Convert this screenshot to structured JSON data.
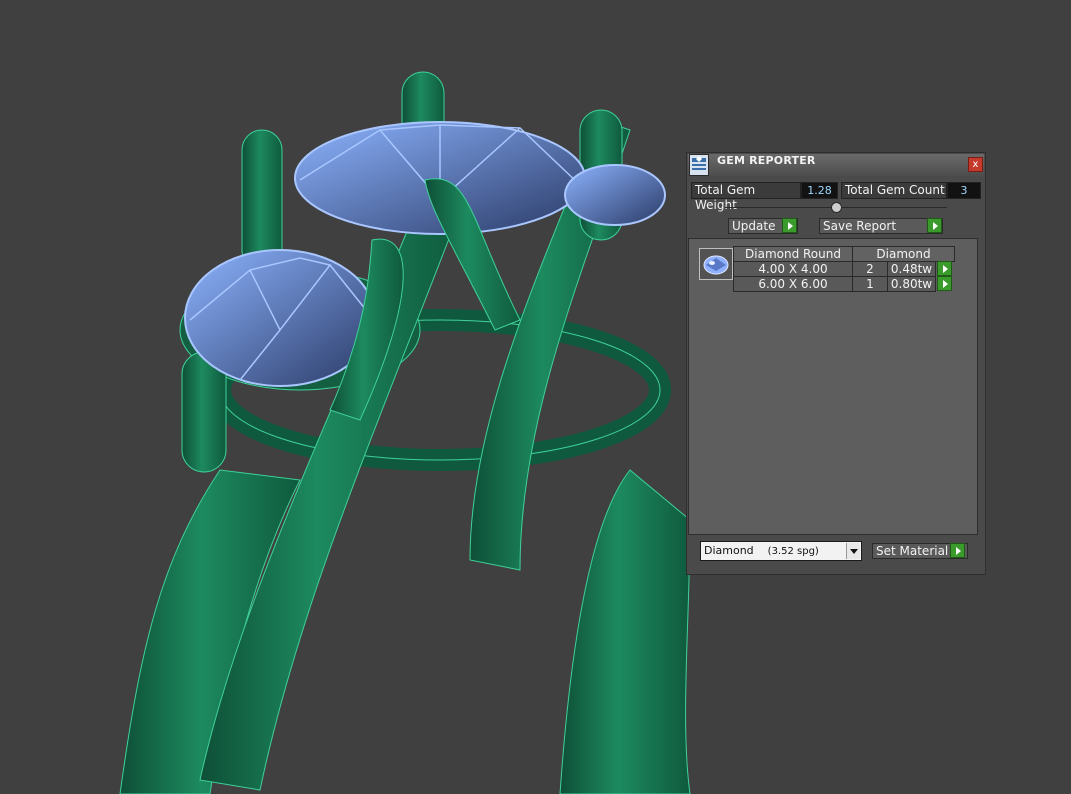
{
  "panel": {
    "title": "GEM REPORTER",
    "close_glyph": "x",
    "icons": {
      "app": "gem-reporter-app-icon",
      "close": "close-icon"
    },
    "total_weight_label": "Total Gem Weight",
    "total_weight_value": "1.28",
    "total_count_label": "Total Gem Count",
    "total_count_value": "3",
    "update_label": "Update",
    "save_report_label": "Save Report",
    "table": {
      "headers": [
        "Diamond Round",
        "Diamond"
      ],
      "rows": [
        {
          "size": "4.00 X 4.00",
          "count": "2",
          "weight": "0.48tw"
        },
        {
          "size": "6.00 X 6.00",
          "count": "1",
          "weight": "0.80tw"
        }
      ]
    },
    "material_select": {
      "name": "Diamond",
      "density": "(3.52 spg)"
    },
    "set_material_label": "Set Material",
    "colors": {
      "go_button": "#3b9a2c",
      "close_button": "#c43a2c",
      "value_text": "#9fd7ff",
      "ring_metal": "#1c7a56",
      "gem": "#8fb6ff"
    }
  }
}
